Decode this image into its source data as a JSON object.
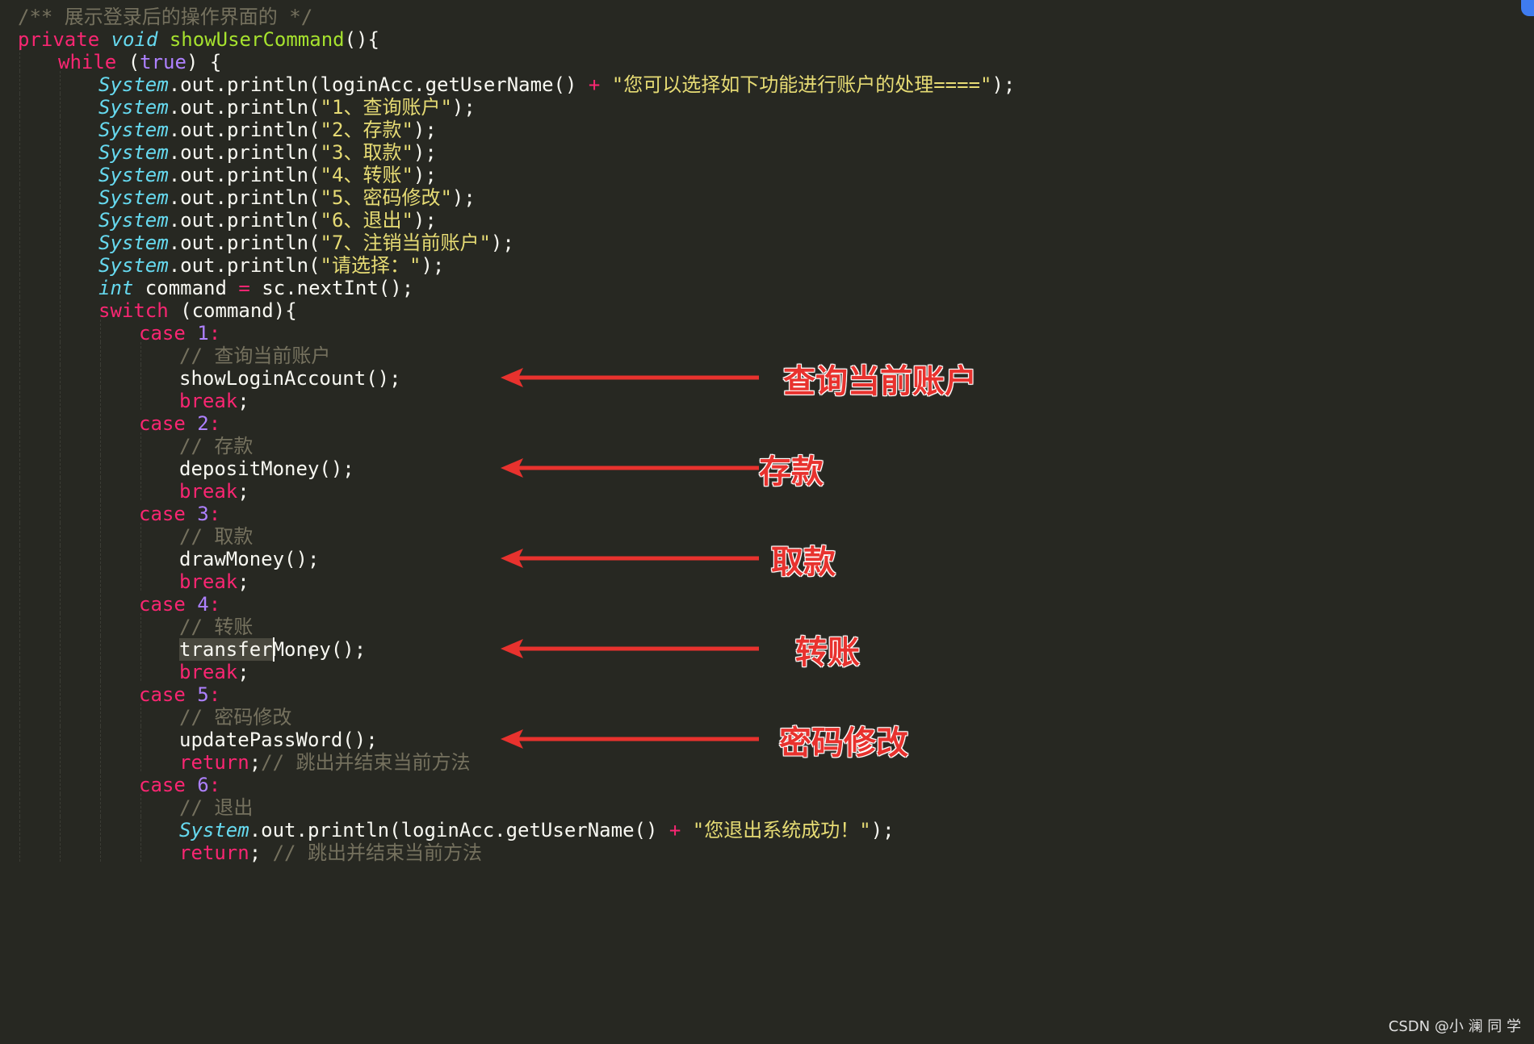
{
  "editor": {
    "lines": [
      {
        "indent": 0,
        "tokens": [
          {
            "t": "/** 展示登录后的操作界面的 */",
            "c": "comment"
          }
        ]
      },
      {
        "indent": 0,
        "tokens": [
          {
            "t": "private",
            "c": "keyword"
          },
          {
            "t": " ",
            "c": "plain"
          },
          {
            "t": "void",
            "c": "type"
          },
          {
            "t": " ",
            "c": "plain"
          },
          {
            "t": "showUserCommand",
            "c": "func"
          },
          {
            "t": "(){",
            "c": "punct"
          }
        ]
      },
      {
        "indent": 1,
        "tokens": [
          {
            "t": "while",
            "c": "keyword"
          },
          {
            "t": " (",
            "c": "punct"
          },
          {
            "t": "true",
            "c": "const"
          },
          {
            "t": ") {",
            "c": "punct"
          }
        ]
      },
      {
        "indent": 2,
        "tokens": [
          {
            "t": "System",
            "c": "class"
          },
          {
            "t": ".out.println(loginAcc.getUserName() ",
            "c": "plain"
          },
          {
            "t": "+",
            "c": "op"
          },
          {
            "t": " ",
            "c": "plain"
          },
          {
            "t": "\"您可以选择如下功能进行账户的处理====\"",
            "c": "string"
          },
          {
            "t": ");",
            "c": "punct"
          }
        ]
      },
      {
        "indent": 2,
        "tokens": [
          {
            "t": "System",
            "c": "class"
          },
          {
            "t": ".out.println(",
            "c": "plain"
          },
          {
            "t": "\"1、查询账户\"",
            "c": "string"
          },
          {
            "t": ");",
            "c": "punct"
          }
        ]
      },
      {
        "indent": 2,
        "tokens": [
          {
            "t": "System",
            "c": "class"
          },
          {
            "t": ".out.println(",
            "c": "plain"
          },
          {
            "t": "\"2、存款\"",
            "c": "string"
          },
          {
            "t": ");",
            "c": "punct"
          }
        ]
      },
      {
        "indent": 2,
        "tokens": [
          {
            "t": "System",
            "c": "class"
          },
          {
            "t": ".out.println(",
            "c": "plain"
          },
          {
            "t": "\"3、取款\"",
            "c": "string"
          },
          {
            "t": ");",
            "c": "punct"
          }
        ]
      },
      {
        "indent": 2,
        "tokens": [
          {
            "t": "System",
            "c": "class"
          },
          {
            "t": ".out.println(",
            "c": "plain"
          },
          {
            "t": "\"4、转账\"",
            "c": "string"
          },
          {
            "t": ");",
            "c": "punct"
          }
        ]
      },
      {
        "indent": 2,
        "tokens": [
          {
            "t": "System",
            "c": "class"
          },
          {
            "t": ".out.println(",
            "c": "plain"
          },
          {
            "t": "\"5、密码修改\"",
            "c": "string"
          },
          {
            "t": ");",
            "c": "punct"
          }
        ]
      },
      {
        "indent": 2,
        "tokens": [
          {
            "t": "System",
            "c": "class"
          },
          {
            "t": ".out.println(",
            "c": "plain"
          },
          {
            "t": "\"6、退出\"",
            "c": "string"
          },
          {
            "t": ");",
            "c": "punct"
          }
        ]
      },
      {
        "indent": 2,
        "tokens": [
          {
            "t": "System",
            "c": "class"
          },
          {
            "t": ".out.println(",
            "c": "plain"
          },
          {
            "t": "\"7、注销当前账户\"",
            "c": "string"
          },
          {
            "t": ");",
            "c": "punct"
          }
        ]
      },
      {
        "indent": 2,
        "tokens": [
          {
            "t": "System",
            "c": "class"
          },
          {
            "t": ".out.println(",
            "c": "plain"
          },
          {
            "t": "\"请选择：\"",
            "c": "string"
          },
          {
            "t": ");",
            "c": "punct"
          }
        ]
      },
      {
        "indent": 2,
        "tokens": [
          {
            "t": "int",
            "c": "type"
          },
          {
            "t": " command ",
            "c": "plain"
          },
          {
            "t": "=",
            "c": "op"
          },
          {
            "t": " sc.nextInt();",
            "c": "plain"
          }
        ]
      },
      {
        "indent": 2,
        "tokens": [
          {
            "t": "switch",
            "c": "keyword"
          },
          {
            "t": " (command){",
            "c": "plain"
          }
        ]
      },
      {
        "indent": 3,
        "tokens": [
          {
            "t": "case",
            "c": "keyword"
          },
          {
            "t": " ",
            "c": "plain"
          },
          {
            "t": "1",
            "c": "number"
          },
          {
            "t": ":",
            "c": "op"
          }
        ]
      },
      {
        "indent": 4,
        "tokens": [
          {
            "t": "// 查询当前账户",
            "c": "comment"
          }
        ]
      },
      {
        "indent": 4,
        "tokens": [
          {
            "t": "showLoginAccount();",
            "c": "plain"
          }
        ]
      },
      {
        "indent": 4,
        "tokens": [
          {
            "t": "break",
            "c": "keyword"
          },
          {
            "t": ";",
            "c": "punct"
          }
        ]
      },
      {
        "indent": 3,
        "tokens": [
          {
            "t": "case",
            "c": "keyword"
          },
          {
            "t": " ",
            "c": "plain"
          },
          {
            "t": "2",
            "c": "number"
          },
          {
            "t": ":",
            "c": "op"
          }
        ]
      },
      {
        "indent": 4,
        "tokens": [
          {
            "t": "// 存款",
            "c": "comment"
          }
        ]
      },
      {
        "indent": 4,
        "tokens": [
          {
            "t": "depositMoney();",
            "c": "plain"
          }
        ]
      },
      {
        "indent": 4,
        "tokens": [
          {
            "t": "break",
            "c": "keyword"
          },
          {
            "t": ";",
            "c": "punct"
          }
        ]
      },
      {
        "indent": 3,
        "tokens": [
          {
            "t": "case",
            "c": "keyword"
          },
          {
            "t": " ",
            "c": "plain"
          },
          {
            "t": "3",
            "c": "number"
          },
          {
            "t": ":",
            "c": "op"
          }
        ]
      },
      {
        "indent": 4,
        "tokens": [
          {
            "t": "// 取款",
            "c": "comment"
          }
        ]
      },
      {
        "indent": 4,
        "tokens": [
          {
            "t": "drawMoney();",
            "c": "plain"
          }
        ]
      },
      {
        "indent": 4,
        "tokens": [
          {
            "t": "break",
            "c": "keyword"
          },
          {
            "t": ";",
            "c": "punct"
          }
        ]
      },
      {
        "indent": 3,
        "tokens": [
          {
            "t": "case",
            "c": "keyword"
          },
          {
            "t": " ",
            "c": "plain"
          },
          {
            "t": "4",
            "c": "number"
          },
          {
            "t": ":",
            "c": "op"
          }
        ]
      },
      {
        "indent": 4,
        "tokens": [
          {
            "t": "// 转账",
            "c": "comment"
          }
        ]
      },
      {
        "indent": 4,
        "tokens": [
          {
            "t": "transfer",
            "c": "select"
          },
          {
            "t": "Money();",
            "c": "plain"
          }
        ]
      },
      {
        "indent": 4,
        "tokens": [
          {
            "t": "break",
            "c": "keyword"
          },
          {
            "t": ";",
            "c": "punct"
          }
        ]
      },
      {
        "indent": 3,
        "tokens": [
          {
            "t": "case",
            "c": "keyword"
          },
          {
            "t": " ",
            "c": "plain"
          },
          {
            "t": "5",
            "c": "number"
          },
          {
            "t": ":",
            "c": "op"
          }
        ]
      },
      {
        "indent": 4,
        "tokens": [
          {
            "t": "// 密码修改",
            "c": "comment"
          }
        ]
      },
      {
        "indent": 4,
        "tokens": [
          {
            "t": "updatePassWord();",
            "c": "plain"
          }
        ]
      },
      {
        "indent": 4,
        "tokens": [
          {
            "t": "return",
            "c": "keyword"
          },
          {
            "t": ";",
            "c": "punct"
          },
          {
            "t": "// 跳出并结束当前方法",
            "c": "comment"
          }
        ]
      },
      {
        "indent": 3,
        "tokens": [
          {
            "t": "case",
            "c": "keyword"
          },
          {
            "t": " ",
            "c": "plain"
          },
          {
            "t": "6",
            "c": "number"
          },
          {
            "t": ":",
            "c": "op"
          }
        ]
      },
      {
        "indent": 4,
        "tokens": [
          {
            "t": "// 退出",
            "c": "comment"
          }
        ]
      },
      {
        "indent": 4,
        "tokens": [
          {
            "t": "System",
            "c": "class"
          },
          {
            "t": ".out.println(loginAcc.getUserName() ",
            "c": "plain"
          },
          {
            "t": "+",
            "c": "op"
          },
          {
            "t": " ",
            "c": "plain"
          },
          {
            "t": "\"您退出系统成功！\"",
            "c": "string"
          },
          {
            "t": ");",
            "c": "punct"
          }
        ]
      },
      {
        "indent": 4,
        "tokens": [
          {
            "t": "return",
            "c": "keyword"
          },
          {
            "t": "; ",
            "c": "punct"
          },
          {
            "t": "// 跳出并结束当前方法",
            "c": "comment"
          }
        ]
      }
    ]
  },
  "annotations": [
    {
      "label": "查询当前账户",
      "target_line": 16
    },
    {
      "label": "存款",
      "target_line": 20
    },
    {
      "label": "取款",
      "target_line": 24
    },
    {
      "label": "转账",
      "target_line": 28
    },
    {
      "label": "密码修改",
      "target_line": 32
    }
  ],
  "annotation_color": "#e8322e",
  "theme": {
    "background": "#272822",
    "comment": "#75715e",
    "keyword": "#f92672",
    "type": "#66d9ef",
    "function": "#a6e22e",
    "string": "#e6db74",
    "number": "#ae81ff",
    "text": "#f8f8f2"
  },
  "watermark": "CSDN @小 澜 同 学"
}
